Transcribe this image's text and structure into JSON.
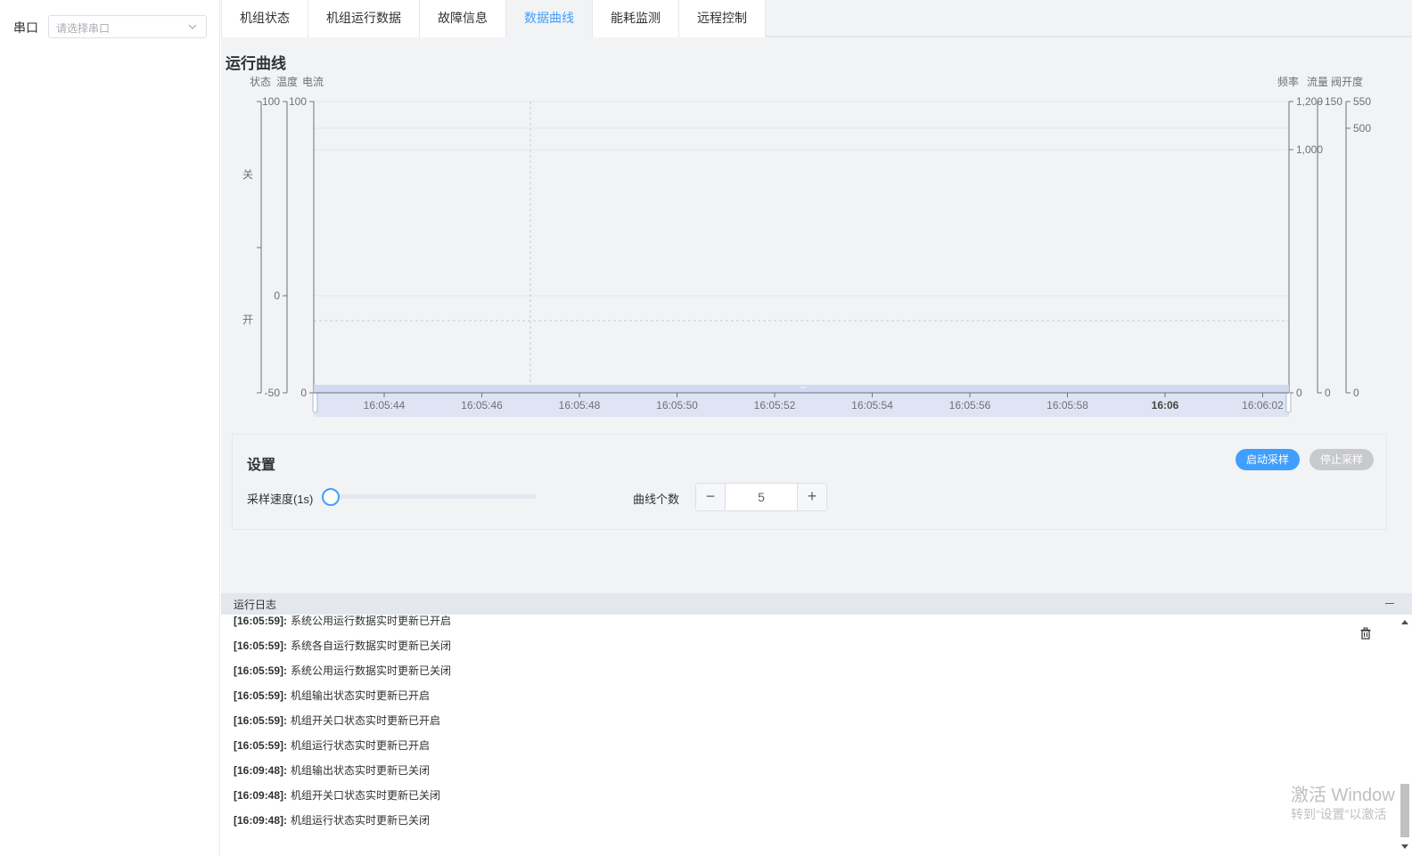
{
  "sidebar": {
    "port_label": "串口",
    "port_placeholder": "请选择串口"
  },
  "tabs": [
    {
      "label": "机组状态",
      "active": false
    },
    {
      "label": "机组运行数据",
      "active": false
    },
    {
      "label": "故障信息",
      "active": false
    },
    {
      "label": "数据曲线",
      "active": true
    },
    {
      "label": "能耗监测",
      "active": false
    },
    {
      "label": "远程控制",
      "active": false
    }
  ],
  "chart_section": {
    "title": "运行曲线"
  },
  "chart_data": {
    "type": "line",
    "title": "",
    "x": [
      "16:05:44",
      "16:05:46",
      "16:05:48",
      "16:05:50",
      "16:05:52",
      "16:05:54",
      "16:05:56",
      "16:05:58",
      "16:06",
      "16:06:02"
    ],
    "left_axes": [
      {
        "name": "状态",
        "ticks": [
          "关",
          "开"
        ],
        "ylim": [
          "开",
          "关"
        ]
      },
      {
        "name": "温度",
        "ticks": [
          "100",
          "0",
          "-50"
        ],
        "ylim": [
          -50,
          100
        ]
      },
      {
        "name": "电流",
        "ticks": [
          "100",
          "0"
        ],
        "ylim": [
          0,
          100
        ]
      }
    ],
    "right_axes": [
      {
        "name": "频率",
        "ticks": [
          "1,200",
          "1,000",
          "0"
        ],
        "ylim": [
          0,
          1200
        ]
      },
      {
        "name": "流量",
        "ticks": [
          "150",
          "0"
        ],
        "ylim": [
          0,
          150
        ]
      },
      {
        "name": "阀开度",
        "ticks": [
          "550",
          "500",
          "0"
        ],
        "ylim": [
          0,
          550
        ]
      }
    ],
    "series": [],
    "grid": true,
    "datazoom_slider": true
  },
  "settings": {
    "title": "设置",
    "start_label": "启动采样",
    "stop_label": "停止采样",
    "speed_label": "采样速度(1s)",
    "speed_value": 0,
    "curve_count_label": "曲线个数",
    "curve_count": "5",
    "minus": "−",
    "plus": "+"
  },
  "log": {
    "title": "运行日志",
    "entries": [
      {
        "time": "[16:05:59]:",
        "text": "系统公用运行数据实时更新已开启"
      },
      {
        "time": "[16:05:59]:",
        "text": "系统各自运行数据实时更新已关闭"
      },
      {
        "time": "[16:05:59]:",
        "text": "系统公用运行数据实时更新已关闭"
      },
      {
        "time": "[16:05:59]:",
        "text": "机组输出状态实时更新已开启"
      },
      {
        "time": "[16:05:59]:",
        "text": "机组开关口状态实时更新已开启"
      },
      {
        "time": "[16:05:59]:",
        "text": "机组运行状态实时更新已开启"
      },
      {
        "time": "[16:09:48]:",
        "text": "机组输出状态实时更新已关闭"
      },
      {
        "time": "[16:09:48]:",
        "text": "机组开关口状态实时更新已关闭"
      },
      {
        "time": "[16:09:48]:",
        "text": "机组运行状态实时更新已关闭"
      }
    ]
  },
  "watermark": {
    "line1": "激活 Window",
    "line2": "转到“设置”以激活"
  },
  "colors": {
    "accent": "#409eff",
    "disabled": "#c8c9cc",
    "background": "#f2f3f5"
  }
}
